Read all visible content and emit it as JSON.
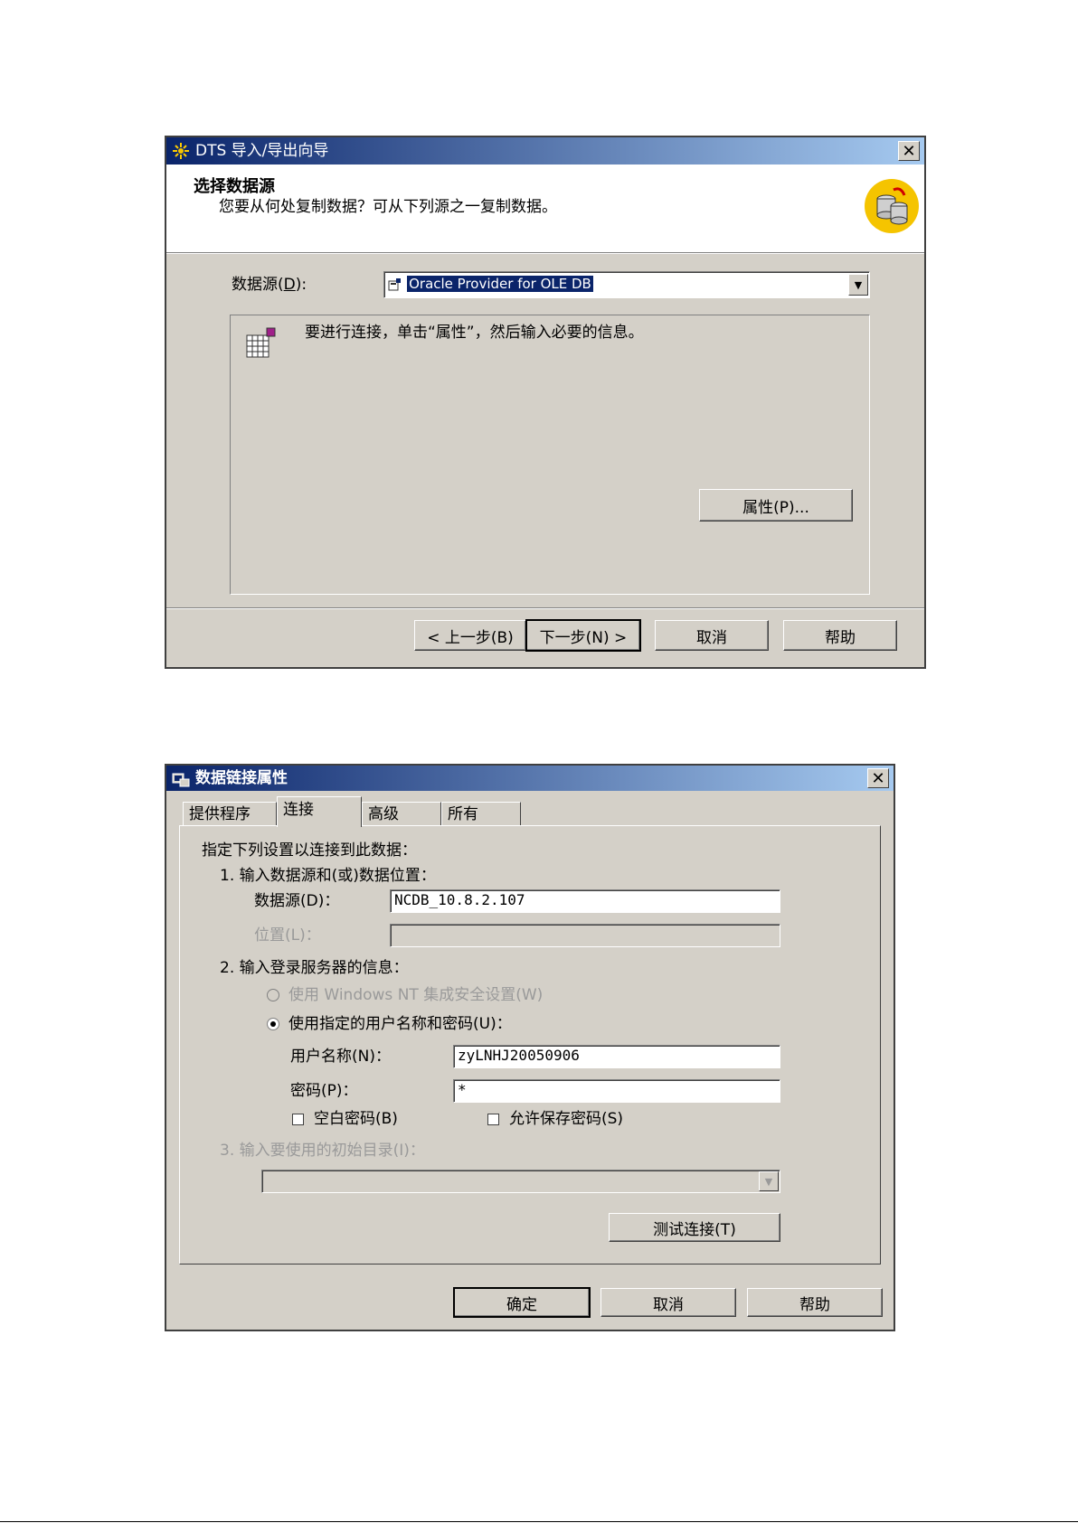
{
  "dialog1": {
    "title": "DTS 导入/导出向导",
    "heading": "选择数据源",
    "subheading": "您要从何处复制数据？可从下列源之一复制数据。",
    "source_label_pre": "数据源(",
    "source_label_key": "D",
    "source_label_post": "):",
    "source_value": "Oracle Provider for OLE DB",
    "info_text": "要进行连接，单击“属性”，然后输入必要的信息。",
    "properties_button": "属性(P)...",
    "back_button": "< 上一步(B)",
    "next_button": "下一步(N) >",
    "cancel_button": "取消",
    "help_button": "帮助"
  },
  "dialog2": {
    "title": "数据链接属性",
    "tabs": [
      "提供程序",
      "连接",
      "高级",
      "所有"
    ],
    "intro": "指定下列设置以连接到此数据：",
    "step1": "1. 输入数据源和(或)数据位置：",
    "datasource_label": "数据源(D)：",
    "datasource_value": "NCDB_10.8.2.107",
    "location_label": "位置(L)：",
    "location_value": "",
    "step2": "2. 输入登录服务器的信息：",
    "radio_nt": "使用 Windows NT 集成安全设置(W)",
    "radio_user": "使用指定的用户名称和密码(U)：",
    "username_label": "用户名称(N)：",
    "username_value": "zyLNHJ20050906",
    "password_label": "密码(P)：",
    "password_value": "*",
    "blank_password": "空白密码(B)",
    "allow_save": "允许保存密码(S)",
    "step3": "3. 输入要使用的初始目录(I)：",
    "catalog_value": "",
    "test_button": "测试连接(T)",
    "ok_button": "确定",
    "cancel_button": "取消",
    "help_button": "帮助"
  },
  "colors": {
    "titlebar_start": "#0a246a",
    "titlebar_end": "#a6caf0",
    "face": "#d4d0c8",
    "selection": "#0a246a"
  }
}
